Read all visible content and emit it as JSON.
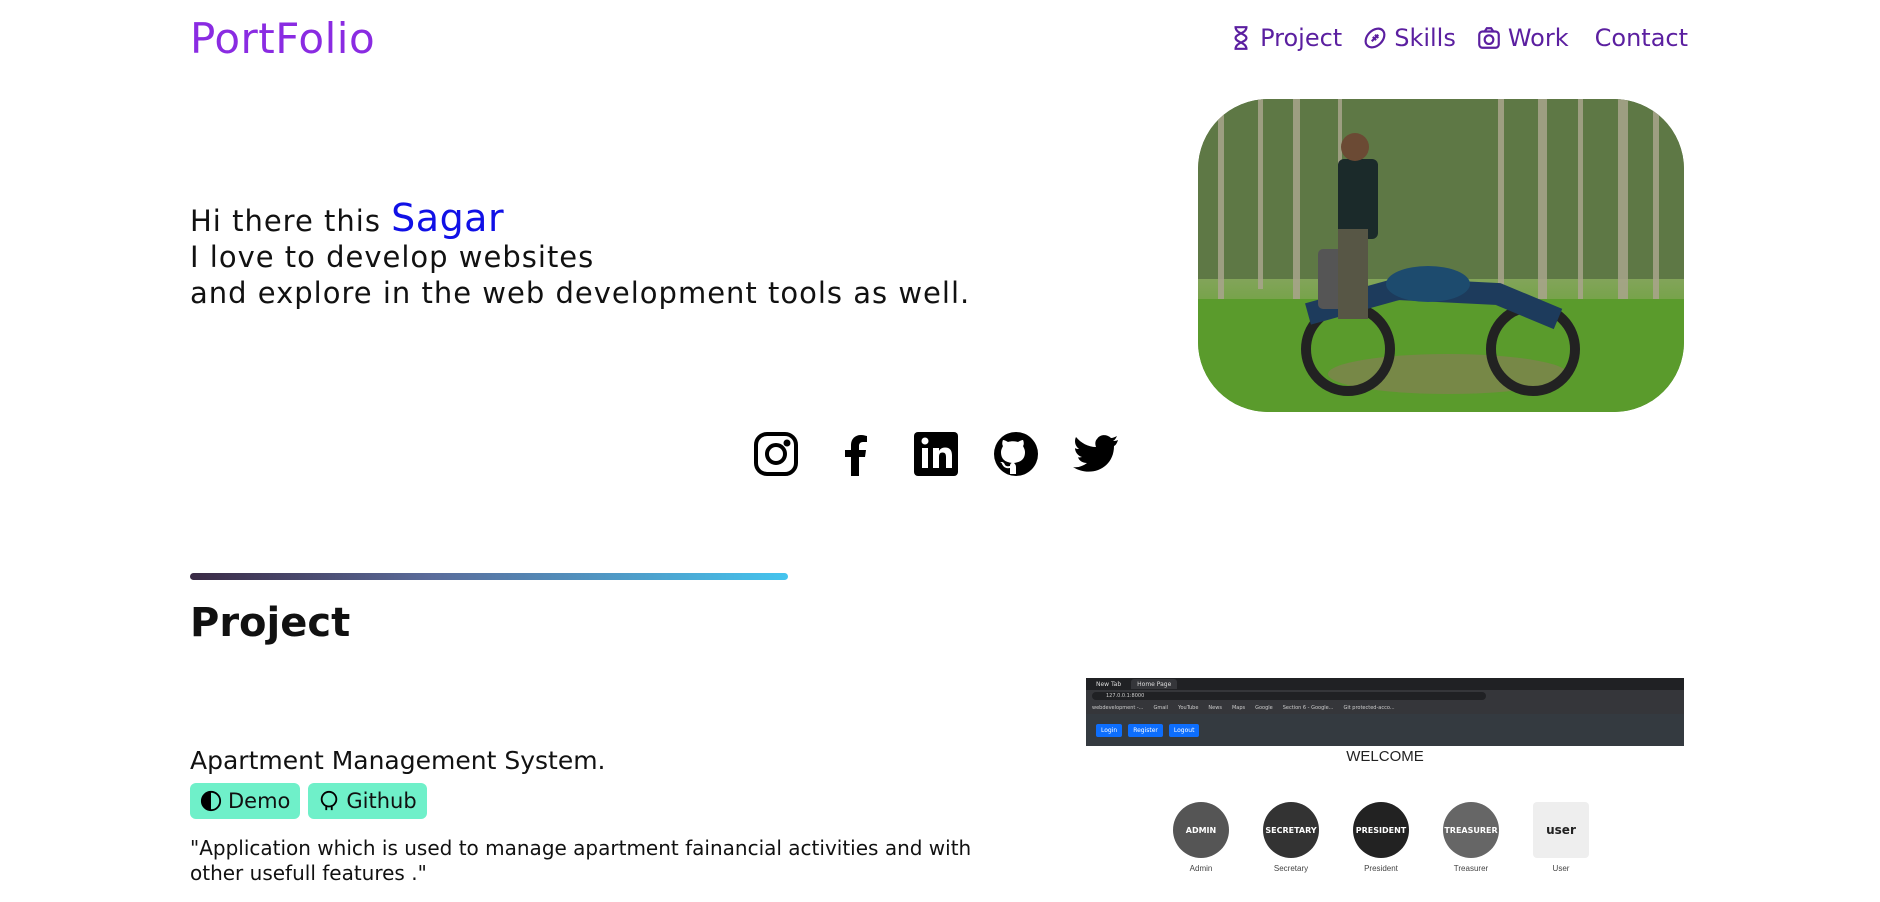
{
  "brand": {
    "logo": "PortFolio",
    "accent": "#8a2be2"
  },
  "nav": {
    "items": [
      {
        "label": "Project",
        "icon": "hourglass-icon"
      },
      {
        "label": "Skills",
        "icon": "football-icon"
      },
      {
        "label": "Work",
        "icon": "camera-icon"
      },
      {
        "label": "Contact",
        "icon": ""
      }
    ]
  },
  "hero": {
    "greeting": "Hi there this ",
    "name": "Sagar",
    "line2": "I love to develop websites",
    "line3": "and explore in the web development tools as well."
  },
  "socials": [
    "instagram-icon",
    "facebook-icon",
    "linkedin-icon",
    "github-icon",
    "twitter-icon"
  ],
  "projects_section": {
    "title": "Project",
    "items": [
      {
        "title": "Apartment Management System.",
        "demo_label": "Demo",
        "github_label": "Github",
        "description": "\"Application which is used to manage apartment fainancial activities and with other usefull features .\"",
        "preview": {
          "tabs": [
            "New Tab",
            "Home Page"
          ],
          "url": "127.0.0.1:8000",
          "bookmarks": [
            "webdevelopment -...",
            "Gmail",
            "YouTube",
            "News",
            "Maps",
            "Google",
            "Section 6 - Google...",
            "Git protected-acco..."
          ],
          "buttons": [
            "Login",
            "Register",
            "Logout"
          ],
          "welcome": "WELCOME",
          "roles": [
            {
              "badge": "ADMIN",
              "label": "Admin",
              "color": "#555555"
            },
            {
              "badge": "SECRETARY",
              "label": "Secretary",
              "color": "#333333"
            },
            {
              "badge": "PRESIDENT",
              "label": "President",
              "color": "#222222"
            },
            {
              "badge": "TREASURER",
              "label": "Treasurer",
              "color": "#666666"
            },
            {
              "badge": "user",
              "label": "User",
              "color": "#eeeeee"
            }
          ]
        }
      }
    ]
  }
}
